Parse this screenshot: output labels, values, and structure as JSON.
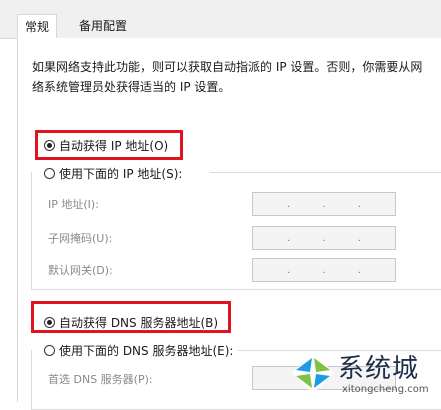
{
  "tabs": [
    {
      "label": "常规",
      "active": true
    },
    {
      "label": "备用配置",
      "active": false
    }
  ],
  "description": {
    "line1": "如果网络支持此功能，则可以获取自动指派的 IP 设置。否则，你需要从网",
    "line2": "络系统管理员处获得适当的 IP 设置。"
  },
  "ip": {
    "auto_label": "自动获得 IP 地址(O)",
    "auto_selected": true,
    "manual_label": "使用下面的 IP 地址(S):",
    "manual_selected": false,
    "fields": [
      {
        "label": "IP 地址(I):",
        "dots": [
          ".",
          ".",
          "."
        ]
      },
      {
        "label": "子网掩码(U):",
        "dots": [
          ".",
          ".",
          "."
        ]
      },
      {
        "label": "默认网关(D):",
        "dots": [
          ".",
          ".",
          "."
        ]
      }
    ]
  },
  "dns": {
    "auto_label": "自动获得 DNS 服务器地址(B)",
    "auto_selected": true,
    "manual_label": "使用下面的 DNS 服务器地址(E):",
    "manual_selected": false,
    "fields": [
      {
        "label": "首选 DNS 服务器(P):"
      }
    ]
  },
  "watermark": {
    "text": "系统城",
    "url": "xitongcheng.com",
    "colors": {
      "blue": "#1e9be6",
      "green": "#7cc243",
      "navy": "#1d2e4a"
    }
  },
  "colors": {
    "highlight": "#e0141e"
  }
}
